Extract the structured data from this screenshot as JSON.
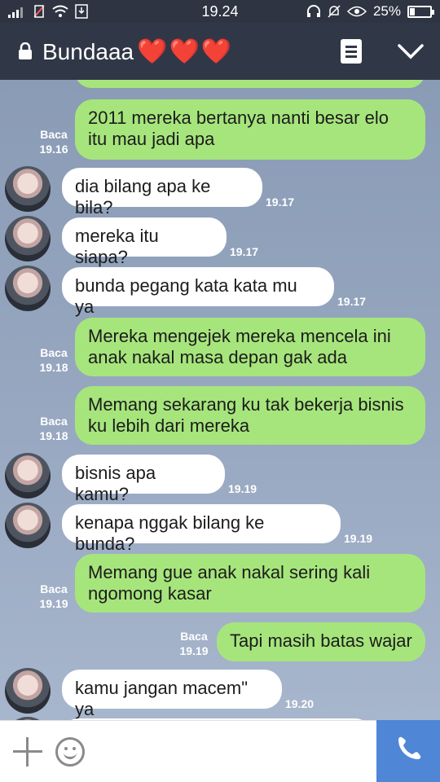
{
  "status_bar": {
    "time": "19.24",
    "battery": "25%",
    "battery_level": 0.25,
    "icons": [
      "signal-icon",
      "no-sim-icon",
      "wifi-icon",
      "download-icon",
      "headset-icon",
      "mute-icon",
      "eye-icon",
      "battery-icon"
    ]
  },
  "header": {
    "title": "Bundaaa",
    "emoji": "❤️❤️❤️",
    "icons": [
      "lock-icon",
      "note-icon",
      "chevron-down-icon"
    ]
  },
  "messages": [
    {
      "dir": "out",
      "text": "2011 mereka bertanya nanti besar elo\nitu mau jadi apa",
      "read": "Baca",
      "time": "19.16"
    },
    {
      "dir": "in",
      "text": "dia bilang apa ke bila?",
      "time": "19.17"
    },
    {
      "dir": "in",
      "text": "mereka itu siapa?",
      "time": "19.17"
    },
    {
      "dir": "in",
      "text": "bunda pegang kata kata mu ya",
      "time": "19.17"
    },
    {
      "dir": "out",
      "text": "Mereka mengejek mereka mencela ini\nanak nakal masa depan gak ada",
      "read": "Baca",
      "time": "19.18"
    },
    {
      "dir": "out",
      "text": "Memang sekarang ku tak bekerja bisnis\nku lebih dari mereka",
      "read": "Baca",
      "time": "19.18"
    },
    {
      "dir": "in",
      "text": "bisnis apa kamu?",
      "time": "19.19"
    },
    {
      "dir": "in",
      "text": "kenapa nggak bilang ke bunda?",
      "time": "19.19"
    },
    {
      "dir": "out",
      "text": "Memang gue anak nakal sering kali\nngomong kasar",
      "read": "Baca",
      "time": "19.19"
    },
    {
      "dir": "out",
      "text": "Tapi masih batas wajar",
      "read": "Baca",
      "time": "19.19"
    },
    {
      "dir": "in",
      "text": "kamu jangan macem\" ya",
      "time": "19.20"
    }
  ],
  "input_bar": {
    "icons": [
      "plus-icon",
      "smiley-icon",
      "phone-icon"
    ]
  },
  "colors": {
    "header_bg": "#303746",
    "out_bubble": "#a6e57c",
    "in_bubble": "#ffffff",
    "call_button": "#4f86d6",
    "heart": "#e0263a"
  }
}
